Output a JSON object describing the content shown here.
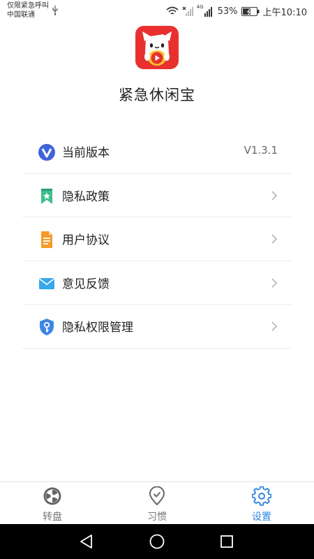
{
  "status_bar": {
    "emergency_text": "仅限紧急呼叫",
    "carrier": "中国联通",
    "network_badge": "4G",
    "battery": "53%",
    "time": "上午10:10"
  },
  "app": {
    "title": "紧急休闲宝",
    "logo_icon": "cat-play-logo-icon"
  },
  "menu": {
    "version": {
      "label": "当前版本",
      "value": "V1.3.1",
      "icon": "vivo-v-icon"
    },
    "privacy_policy": {
      "label": "隐私政策",
      "icon": "bookmark-star-icon"
    },
    "user_agreement": {
      "label": "用户协议",
      "icon": "document-icon"
    },
    "feedback": {
      "label": "意见反馈",
      "icon": "envelope-icon"
    },
    "privacy_permissions": {
      "label": "隐私权限管理",
      "icon": "shield-key-icon"
    }
  },
  "tabs": {
    "wheel": {
      "label": "转盘",
      "icon": "wheel-icon"
    },
    "habit": {
      "label": "习惯",
      "icon": "location-check-icon"
    },
    "settings": {
      "label": "设置",
      "icon": "gear-icon",
      "active": true
    }
  },
  "colors": {
    "accent": "#2f86e0",
    "logo_red": "#e8312f",
    "tab_inactive": "#777777"
  }
}
